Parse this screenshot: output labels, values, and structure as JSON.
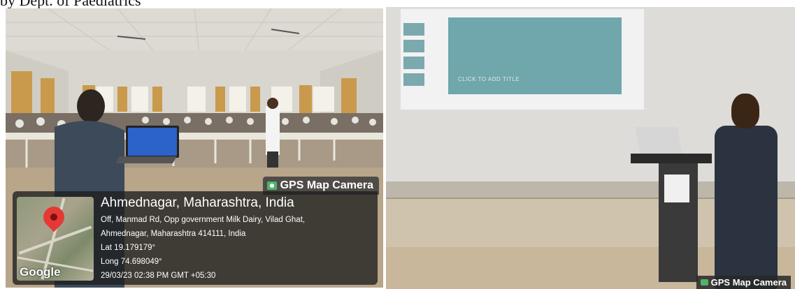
{
  "caption": "by Dept. of Paediatrics",
  "left_photo": {
    "badge_label": "GPS Map Camera",
    "location_title": "Ahmednagar, Maharashtra, India",
    "address_line_1": "Off, Manmad Rd, Opp government Milk Dairy, Vilad Ghat,",
    "address_line_2": "Ahmednagar, Maharashtra 414111, India",
    "latitude": "Lat 19.179179°",
    "longitude": "Long 74.698049°",
    "timestamp": "29/03/23 02:38 PM GMT +05:30",
    "map_logo": "Google"
  },
  "right_photo": {
    "slide_placeholder": "CLICK TO ADD TITLE",
    "badge_label": "GPS Map Camera"
  },
  "colors": {
    "pin": "#e53935",
    "camera_icon": "#4fb36b",
    "laptop_screen": "#2b63c9",
    "slide": "#6fa7ad"
  }
}
